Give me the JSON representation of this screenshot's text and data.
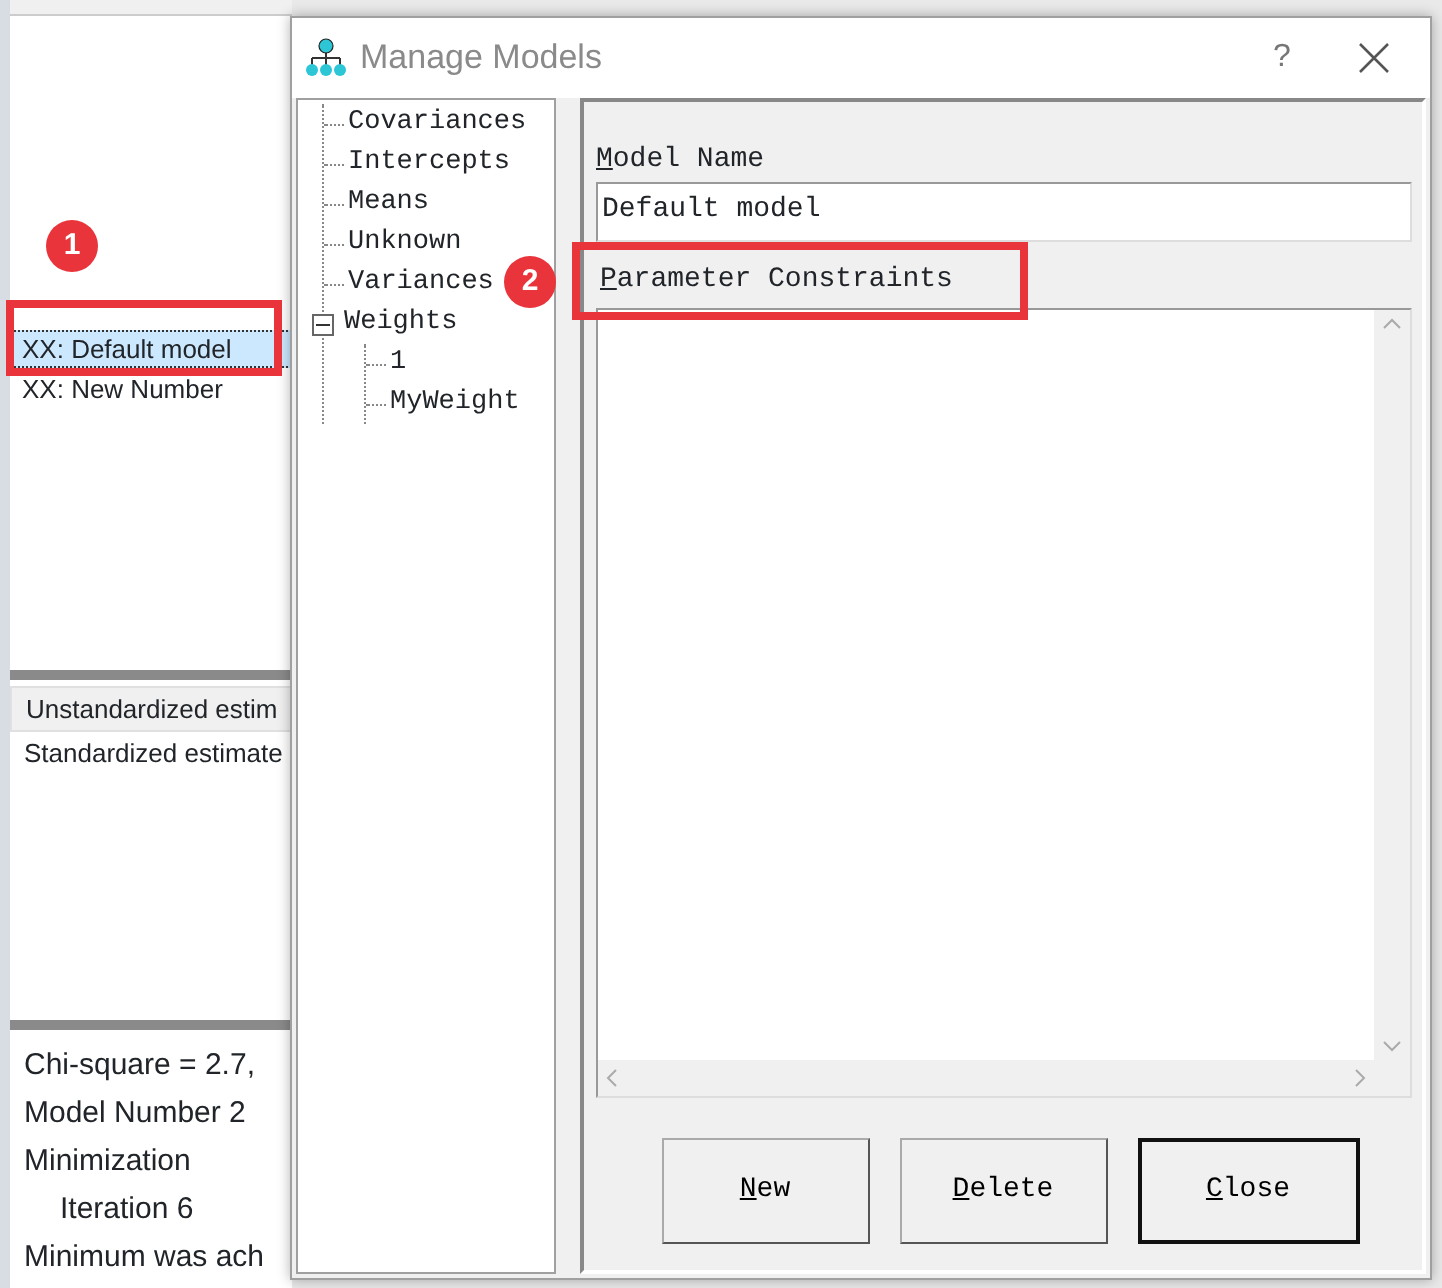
{
  "background_window": {
    "models": [
      {
        "label": "XX: Default model",
        "selected": true
      },
      {
        "label": "XX: New Number",
        "selected": false
      }
    ],
    "estimates": [
      {
        "label": "Unstandardized estim",
        "selected": true
      },
      {
        "label": "Standardized estimate",
        "selected": false
      }
    ],
    "messages": [
      {
        "text": "Chi-square = 2.7,"
      },
      {
        "text": "Model Number 2"
      },
      {
        "text": "Minimization",
        "children": [
          {
            "text": "Iteration 6"
          }
        ]
      },
      {
        "text": "Minimum was ach"
      }
    ]
  },
  "dialog": {
    "title": "Manage Models",
    "help": "?",
    "tree": [
      {
        "label": "Covariances"
      },
      {
        "label": "Intercepts"
      },
      {
        "label": "Means"
      },
      {
        "label": "Unknown"
      },
      {
        "label": "Variances"
      },
      {
        "label": "Weights",
        "expanded": true,
        "children": [
          {
            "label": "1"
          },
          {
            "label": "MyWeight"
          }
        ]
      }
    ],
    "model_name_label": "Model Name",
    "model_name_value": "Default model",
    "constraints_label": "Parameter Constraints",
    "buttons": [
      {
        "label": "New",
        "default": false
      },
      {
        "label": "Delete",
        "default": false
      },
      {
        "label": "Close",
        "default": true
      }
    ]
  },
  "callouts": [
    {
      "number": "1"
    },
    {
      "number": "2"
    }
  ]
}
